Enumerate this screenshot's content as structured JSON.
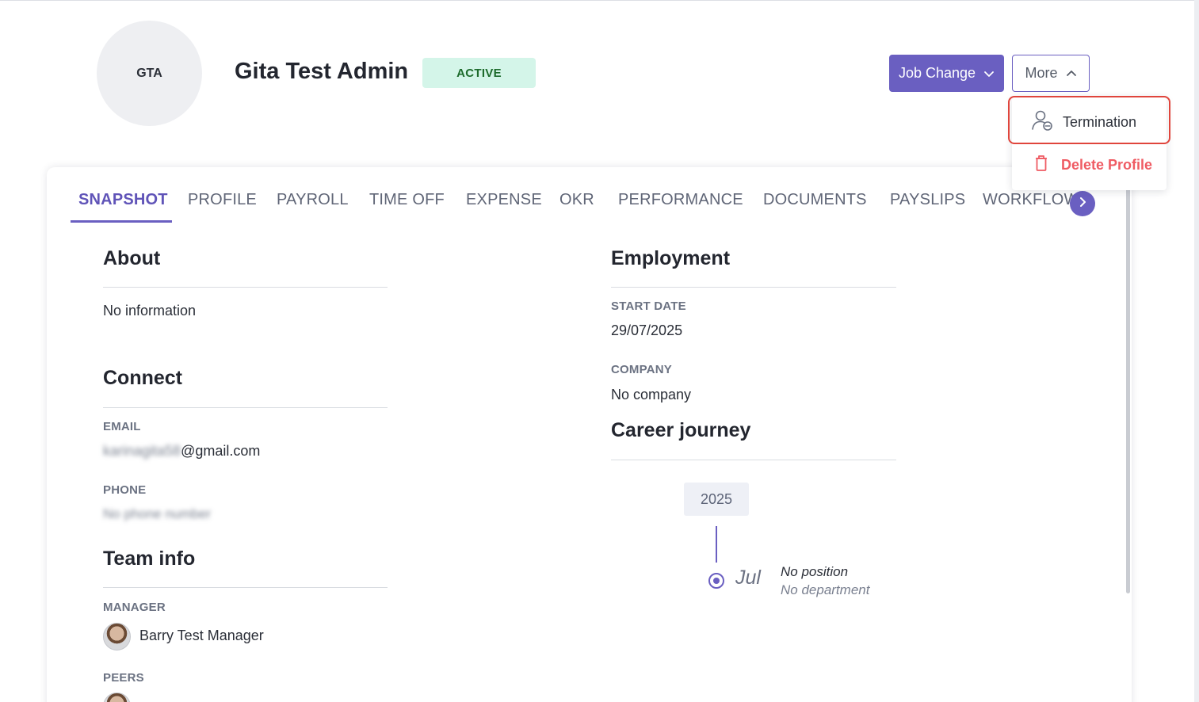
{
  "profile": {
    "initials": "GTA",
    "name": "Gita Test Admin",
    "status": "ACTIVE"
  },
  "actions": {
    "job_change": "Job Change",
    "more": "More"
  },
  "more_menu": {
    "items": [
      {
        "label": "Termination",
        "icon": "person-remove-icon"
      },
      {
        "label": "Delete Profile",
        "icon": "trash-icon"
      }
    ]
  },
  "tabs": [
    "SNAPSHOT",
    "PROFILE",
    "PAYROLL",
    "TIME OFF",
    "EXPENSE",
    "OKR",
    "PERFORMANCE",
    "DOCUMENTS",
    "PAYSLIPS",
    "WORKFLOW"
  ],
  "active_tab": "SNAPSHOT",
  "about": {
    "title": "About",
    "text": "No information"
  },
  "connect": {
    "title": "Connect",
    "email_label": "EMAIL",
    "email_redacted": "karinagita58",
    "email_domain": "@gmail.com",
    "phone_label": "PHONE",
    "phone_value": "No phone number"
  },
  "team": {
    "title": "Team info",
    "manager_label": "MANAGER",
    "manager_name": "Barry Test Manager",
    "peers_label": "PEERS"
  },
  "employment": {
    "title": "Employment",
    "start_date_label": "START DATE",
    "start_date": "29/07/2025",
    "company_label": "COMPANY",
    "company": "No company"
  },
  "career": {
    "title": "Career journey",
    "year": "2025",
    "month": "Jul",
    "position": "No position",
    "department": "No department"
  },
  "colors": {
    "accent": "#6a5fc1",
    "active_badge_bg": "#d4f5e9",
    "danger": "#ef5b63",
    "highlight": "#e0453c"
  }
}
